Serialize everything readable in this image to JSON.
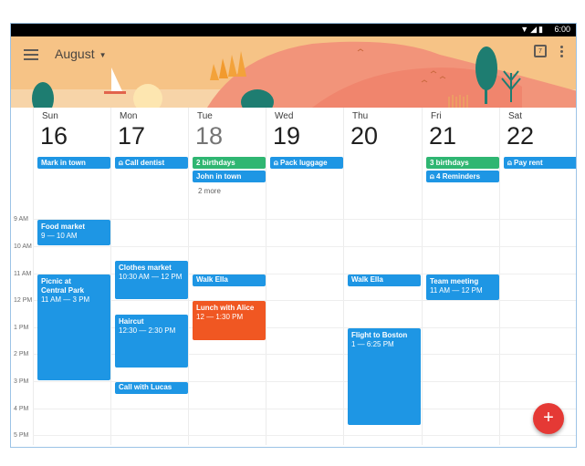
{
  "status_bar": {
    "time": "6:00",
    "icons": [
      "wifi-icon",
      "signal-icon",
      "battery-icon"
    ]
  },
  "header": {
    "month": "August",
    "calendar_icon_day": "7"
  },
  "days": [
    {
      "name": "Sun",
      "num": "16"
    },
    {
      "name": "Mon",
      "num": "17"
    },
    {
      "name": "Tue",
      "num": "18"
    },
    {
      "name": "Wed",
      "num": "19"
    },
    {
      "name": "Thu",
      "num": "20"
    },
    {
      "name": "Fri",
      "num": "21"
    },
    {
      "name": "Sat",
      "num": "22"
    }
  ],
  "all_day": {
    "sun": [
      "Mark in town"
    ],
    "mon": [
      "Call dentist"
    ],
    "tue": [
      "2 birthdays",
      "John in town"
    ],
    "tue_more": "2 more",
    "wed": [
      "Pack luggage"
    ],
    "fri": [
      "3 birthdays",
      "4 Reminders"
    ],
    "sat": [
      "Pay rent"
    ]
  },
  "hours": [
    "9 AM",
    "10 AM",
    "11 AM",
    "12 PM",
    "1 PM",
    "2 PM",
    "3 PM",
    "4 PM",
    "5 PM"
  ],
  "events": {
    "food_market": {
      "title": "Food market",
      "time": "9 — 10 AM"
    },
    "picnic": {
      "title": "Picnic at\nCentral Park",
      "time": "11 AM — 3 PM"
    },
    "clothes_market": {
      "title": "Clothes market",
      "time": "10:30 AM — 12 PM"
    },
    "haircut": {
      "title": "Haircut",
      "time": "12:30 — 2:30 PM"
    },
    "call_lucas": {
      "title": "Call with Lucas"
    },
    "walk_ella_tue": {
      "title": "Walk Ella"
    },
    "lunch_alice": {
      "title": "Lunch with Alice",
      "time": "12 — 1:30 PM"
    },
    "walk_ella_thu": {
      "title": "Walk Ella"
    },
    "flight_boston": {
      "title": "Flight to Boston",
      "time": "1 — 6:25 PM"
    },
    "team_meeting": {
      "title": "Team meeting",
      "time": "11 AM — 12 PM"
    }
  },
  "fab": {
    "label": "+"
  },
  "colors": {
    "event_blue": "#1e96e4",
    "birthday_green": "#2fb672",
    "event_orange": "#f05722",
    "fab_red": "#e53935",
    "header_bg": "#f6c386"
  }
}
